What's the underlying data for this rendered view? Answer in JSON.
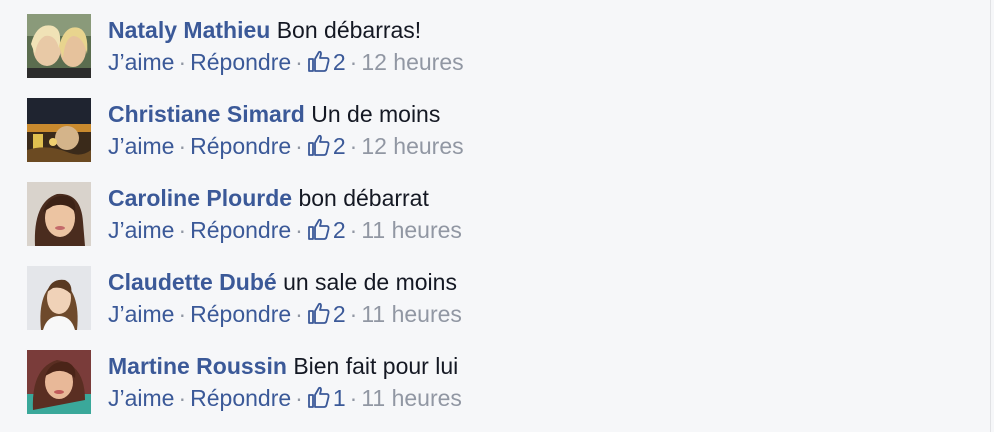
{
  "colors": {
    "author_link": "#3b5998",
    "meta_gray": "#9197a3",
    "text": "#141823",
    "background": "#f6f7f9"
  },
  "labels": {
    "like": "J’aime",
    "reply": "Répondre",
    "separator": "·"
  },
  "comments": [
    {
      "author": "Nataly Mathieu",
      "text": "Bon débarras!",
      "likes": "2",
      "time": "12 heures"
    },
    {
      "author": "Christiane Simard",
      "text": "Un de moins",
      "likes": "2",
      "time": "12 heures"
    },
    {
      "author": "Caroline Plourde",
      "text": "bon débarrat",
      "likes": "2",
      "time": "11 heures"
    },
    {
      "author": "Claudette Dubé",
      "text": "un sale de moins",
      "likes": "2",
      "time": "11 heures"
    },
    {
      "author": "Martine Roussin",
      "text": "Bien fait pour lui",
      "likes": "1",
      "time": "11 heures"
    }
  ],
  "icons": {
    "like_count": "thumbs-up-icon"
  }
}
